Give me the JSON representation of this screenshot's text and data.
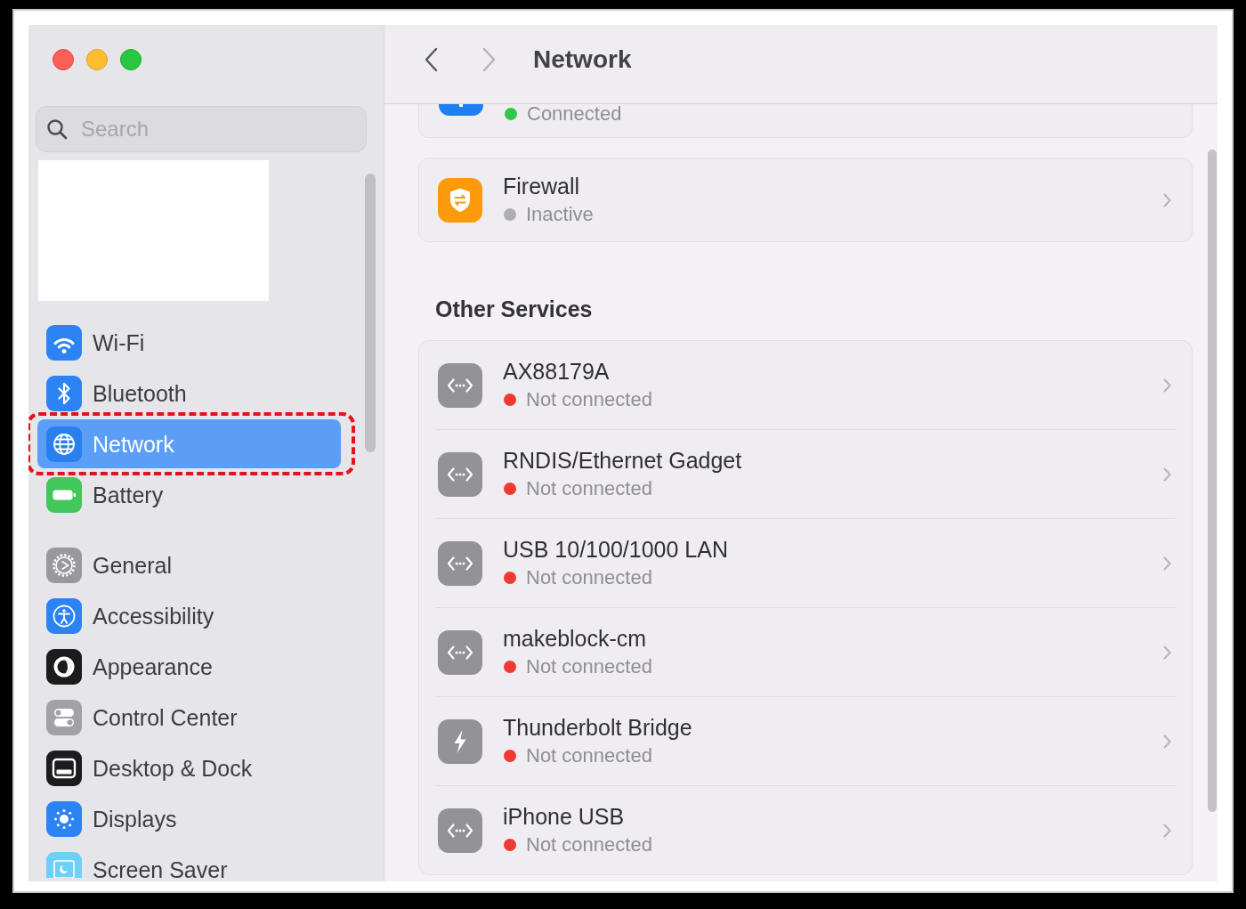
{
  "window": {
    "controls": [
      {
        "kind": "close"
      },
      {
        "kind": "minimize"
      },
      {
        "kind": "zoom"
      }
    ]
  },
  "sidebar": {
    "search": {
      "placeholder": "Search"
    },
    "groups": [
      {
        "items": [
          {
            "kind": "wifi",
            "label": "Wi-Fi",
            "selected": false,
            "highlighted": false
          },
          {
            "kind": "bluetooth",
            "label": "Bluetooth",
            "selected": false,
            "highlighted": false
          },
          {
            "kind": "network",
            "label": "Network",
            "selected": true,
            "highlighted": true
          },
          {
            "kind": "battery",
            "label": "Battery",
            "selected": false,
            "highlighted": false
          }
        ]
      },
      {
        "items": [
          {
            "kind": "general",
            "label": "General",
            "selected": false,
            "highlighted": false
          },
          {
            "kind": "accessibility",
            "label": "Accessibility",
            "selected": false,
            "highlighted": false
          },
          {
            "kind": "appearance",
            "label": "Appearance",
            "selected": false,
            "highlighted": false
          },
          {
            "kind": "control_center",
            "label": "Control Center",
            "selected": false,
            "highlighted": false
          },
          {
            "kind": "desktop_dock",
            "label": "Desktop & Dock",
            "selected": false,
            "highlighted": false
          },
          {
            "kind": "displays",
            "label": "Displays",
            "selected": false,
            "highlighted": false
          },
          {
            "kind": "screen_saver",
            "label": "Screen Saver",
            "selected": false,
            "highlighted": false
          }
        ]
      }
    ]
  },
  "header": {
    "back": {
      "disabled": false
    },
    "forward": {
      "disabled": true
    },
    "title": "Network"
  },
  "status_card": {
    "status": "Connected",
    "color": "#30c84b"
  },
  "firewall_card": {
    "kind": "firewall",
    "name": "Firewall",
    "status": "Inactive",
    "color": "#aeaeb2"
  },
  "other_services": {
    "heading": "Other Services",
    "items": [
      {
        "kind": "ethernet",
        "name": "AX88179A",
        "status": "Not connected",
        "color": "#ee3a32"
      },
      {
        "kind": "ethernet",
        "name": "RNDIS/Ethernet Gadget",
        "status": "Not connected",
        "color": "#ee3a32"
      },
      {
        "kind": "ethernet",
        "name": "USB 10/100/1000 LAN",
        "status": "Not connected",
        "color": "#ee3a32"
      },
      {
        "kind": "ethernet",
        "name": "makeblock-cm",
        "status": "Not connected",
        "color": "#ee3a32"
      },
      {
        "kind": "thunderbolt",
        "name": "Thunderbolt Bridge",
        "status": "Not connected",
        "color": "#ee3a32"
      },
      {
        "kind": "ethernet",
        "name": "iPhone USB",
        "status": "Not connected",
        "color": "#ee3a32"
      }
    ]
  }
}
